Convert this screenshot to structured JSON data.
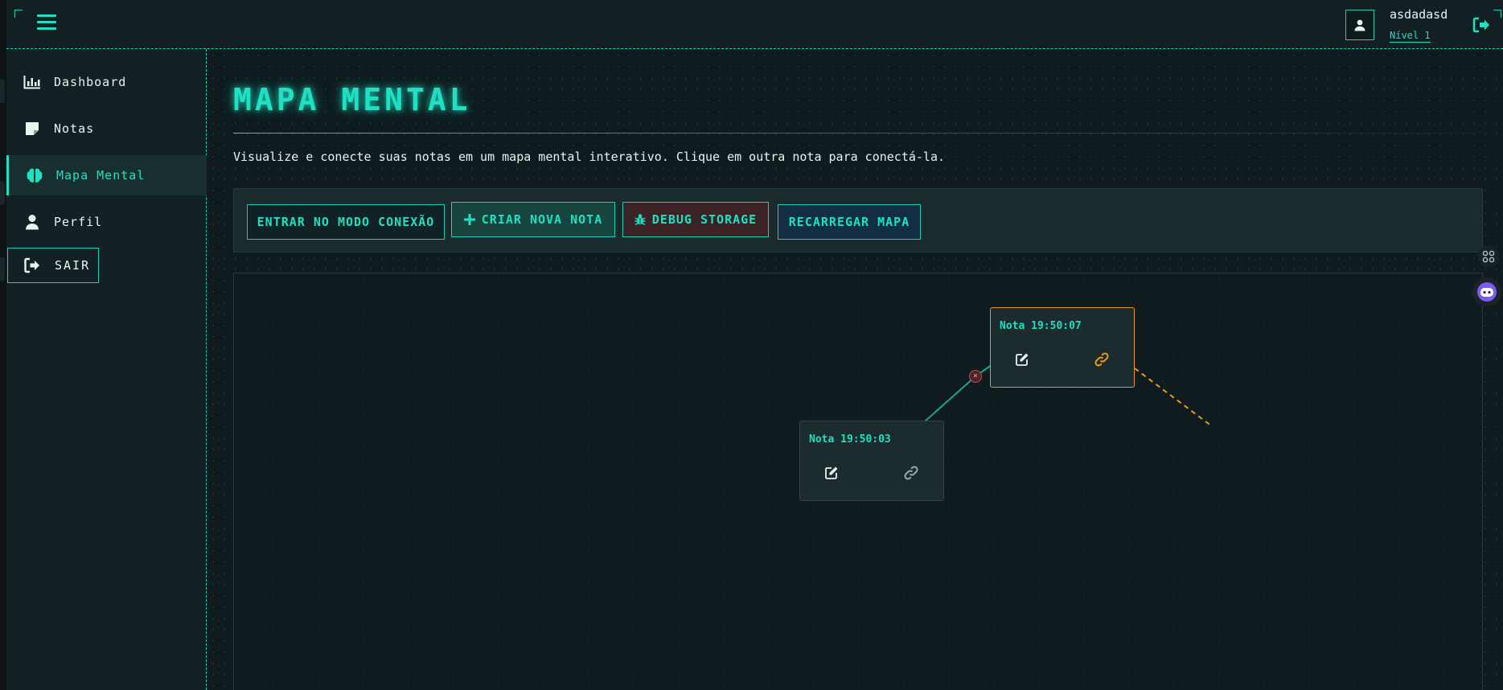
{
  "header": {
    "user": {
      "name": "asdadasd",
      "level": "Nível 1"
    }
  },
  "sidebar": {
    "items": [
      {
        "label": "Dashboard",
        "icon": "chart-bar-icon",
        "active": false
      },
      {
        "label": "Notas",
        "icon": "sticky-note-icon",
        "active": false
      },
      {
        "label": "Mapa Mental",
        "icon": "brain-icon",
        "active": true
      },
      {
        "label": "Perfil",
        "icon": "user-icon",
        "active": false
      }
    ],
    "logout_label": "SAIR"
  },
  "main": {
    "title": "MAPA MENTAL",
    "description": "Visualize e conecte suas notas em um mapa mental interativo. Clique em outra nota para conectá-la.",
    "toolbar": {
      "connect_label": "ENTRAR NO MODO CONEXÃO",
      "create_label": "CRIAR NOVA NOTA",
      "debug_label": "DEBUG STORAGE",
      "reload_label": "RECARREGAR MAPA"
    },
    "notes": [
      {
        "title": "Nota 19:50:07",
        "selected": true
      },
      {
        "title": "Nota 19:50:03",
        "selected": false
      }
    ],
    "edge_delete_label": "×"
  },
  "colors": {
    "accent": "#1fe0c2",
    "selected_border": "#e89a1e",
    "delete": "#c94a50",
    "background": "#0f1b1e"
  }
}
